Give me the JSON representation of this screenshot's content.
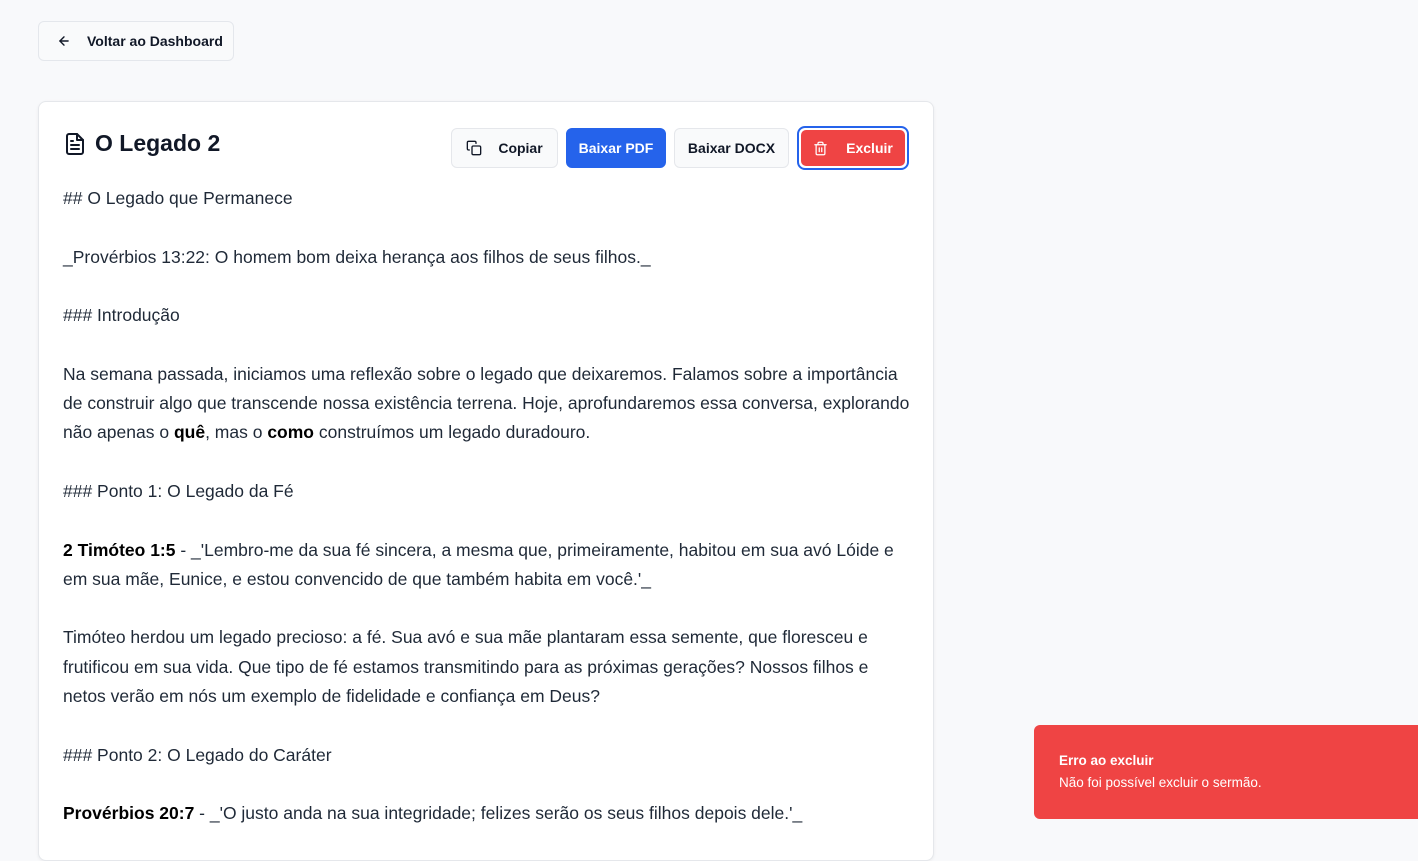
{
  "nav": {
    "back_label": "Voltar ao Dashboard"
  },
  "sermon": {
    "title": "O Legado 2",
    "actions": {
      "copy_label": "Copiar",
      "pdf_label": "Baixar PDF",
      "docx_label": "Baixar DOCX",
      "delete_label": "Excluir"
    },
    "body": {
      "heading": "## O Legado que Permanece",
      "verse_intro": "_Provérbios 13:22: O homem bom deixa herança aos filhos de seus filhos._",
      "section_intro": "### Introdução",
      "intro_a": "Na semana passada, iniciamos uma reflexão sobre o legado que deixaremos.  Falamos sobre a importância de construir algo que transcende nossa existência terrena. Hoje, aprofundaremos essa conversa, explorando não apenas o ",
      "intro_bold_1": "quê",
      "intro_b": ", mas o ",
      "intro_bold_2": "como",
      "intro_c": " construímos um legado duradouro.",
      "section_point1": "### Ponto 1: O Legado da Fé",
      "point1_ref": "2 Timóteo 1:5",
      "point1_quote": " - _'Lembro-me da sua fé sincera, a mesma que, primeiramente, habitou em sua avó Lóide e em sua mãe, Eunice, e estou convencido de que também habita em você.'_",
      "point1_text": "Timóteo herdou um legado precioso: a fé. Sua avó e sua mãe plantaram essa semente, que floresceu e frutificou em sua vida. Que tipo de fé estamos transmitindo para as próximas gerações? Nossos filhos e netos verão em nós um exemplo de fidelidade e confiança em Deus?",
      "section_point2": "### Ponto 2: O Legado do Caráter",
      "point2_ref": "Provérbios 20:7",
      "point2_quote": " - _'O justo anda na sua integridade; felizes serão os seus filhos depois dele.'_"
    }
  },
  "toast": {
    "title": "Erro ao excluir",
    "description": "Não foi possível excluir o sermão."
  },
  "colors": {
    "primary": "#2563eb",
    "danger": "#ef4444",
    "background": "#f8f9fb"
  },
  "icons": {
    "back": "arrow-left-icon",
    "document": "file-text-icon",
    "copy": "copy-icon",
    "delete": "trash-icon"
  }
}
